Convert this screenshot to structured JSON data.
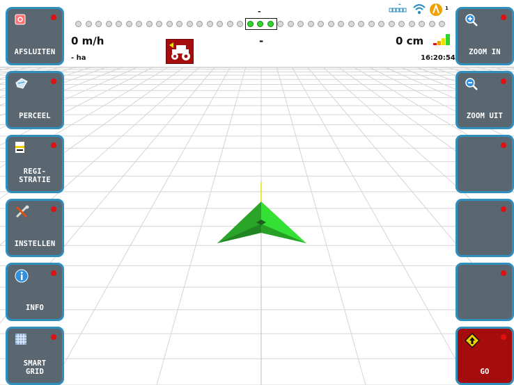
{
  "left_buttons": [
    {
      "label": "AFSLUITEN",
      "icon": "exit-icon"
    },
    {
      "label": "PERCEEL",
      "icon": "field-icon"
    },
    {
      "label": "REGI-\nSTRATIE",
      "icon": "registration-icon"
    },
    {
      "label": "INSTELLEN",
      "icon": "settings-icon"
    },
    {
      "label": "INFO",
      "icon": "info-icon"
    },
    {
      "label": "SMART\nGRID",
      "icon": "grid-icon"
    }
  ],
  "right_buttons": [
    {
      "label": "ZOOM IN",
      "icon": "zoom-in-icon"
    },
    {
      "label": "ZOOM UIT",
      "icon": "zoom-out-icon"
    },
    {
      "label": ""
    },
    {
      "label": ""
    },
    {
      "label": ""
    },
    {
      "label": "GO",
      "icon": "go-icon"
    }
  ],
  "status": {
    "speed": "0 m/h",
    "area": "- ha",
    "lightbar_value": "-",
    "center_value": "-",
    "offset": "0 cm",
    "time": "16:20:54",
    "gps_sat_count": "1",
    "gps_top_label": "-"
  },
  "lightbar": {
    "total_dots": 37,
    "active_dots": 3
  },
  "colors": {
    "button_bg": "#5b6770",
    "button_border": "#2f8fbe",
    "go_bg": "#a50d0d",
    "led_red": "#e01010",
    "lightbar_active": "#2ed52e",
    "vehicle_green": "#2aa52a"
  }
}
